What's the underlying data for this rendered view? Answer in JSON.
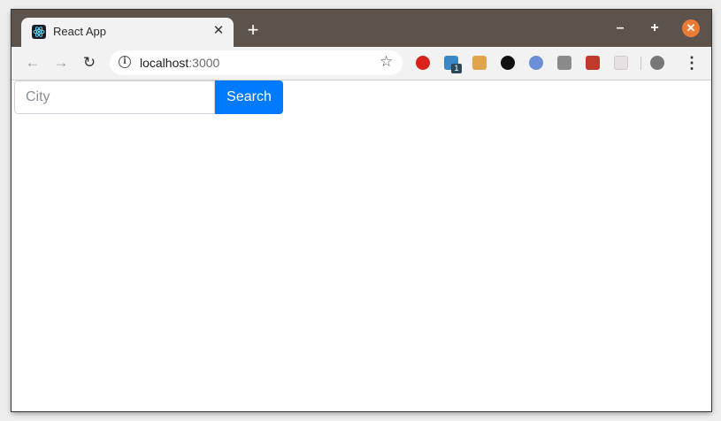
{
  "browser": {
    "tab": {
      "title": "React App",
      "close": "✕"
    },
    "new_tab": "+",
    "window_controls": {
      "minimize": "–",
      "maximize": "+",
      "close": "✕"
    },
    "nav": {
      "back": "←",
      "forward": "→",
      "reload": "↻"
    },
    "address": {
      "host": "localhost",
      "port": ":3000"
    },
    "info_icon": "i",
    "bookmark_icon": "☆",
    "extensions": [
      {
        "name": "red-shield-extension-icon",
        "color": "#d8231a"
      },
      {
        "name": "blue-extension-icon",
        "color": "#3c86c3",
        "badge": "1"
      },
      {
        "name": "orange-box-extension-icon",
        "color": "#e0a54a"
      },
      {
        "name": "paw-extension-icon",
        "color": "#111111"
      },
      {
        "name": "blue-orb-extension-icon",
        "color": "#6a8fd6"
      },
      {
        "name": "grey-tool-extension-icon",
        "color": "#8a8a8a"
      },
      {
        "name": "red-monster-extension-icon",
        "color": "#c0392b"
      },
      {
        "name": "calendar-extension-icon",
        "color": "#e7e1e1"
      },
      {
        "name": "profile-avatar-icon",
        "color": "#777777"
      }
    ],
    "menu_icon": "⋮"
  },
  "app": {
    "search": {
      "placeholder": "City",
      "value": "",
      "button_label": "Search"
    }
  },
  "colors": {
    "titlebar": "#5c534c",
    "primary_button": "#007bff",
    "window_close": "#e97b36"
  }
}
